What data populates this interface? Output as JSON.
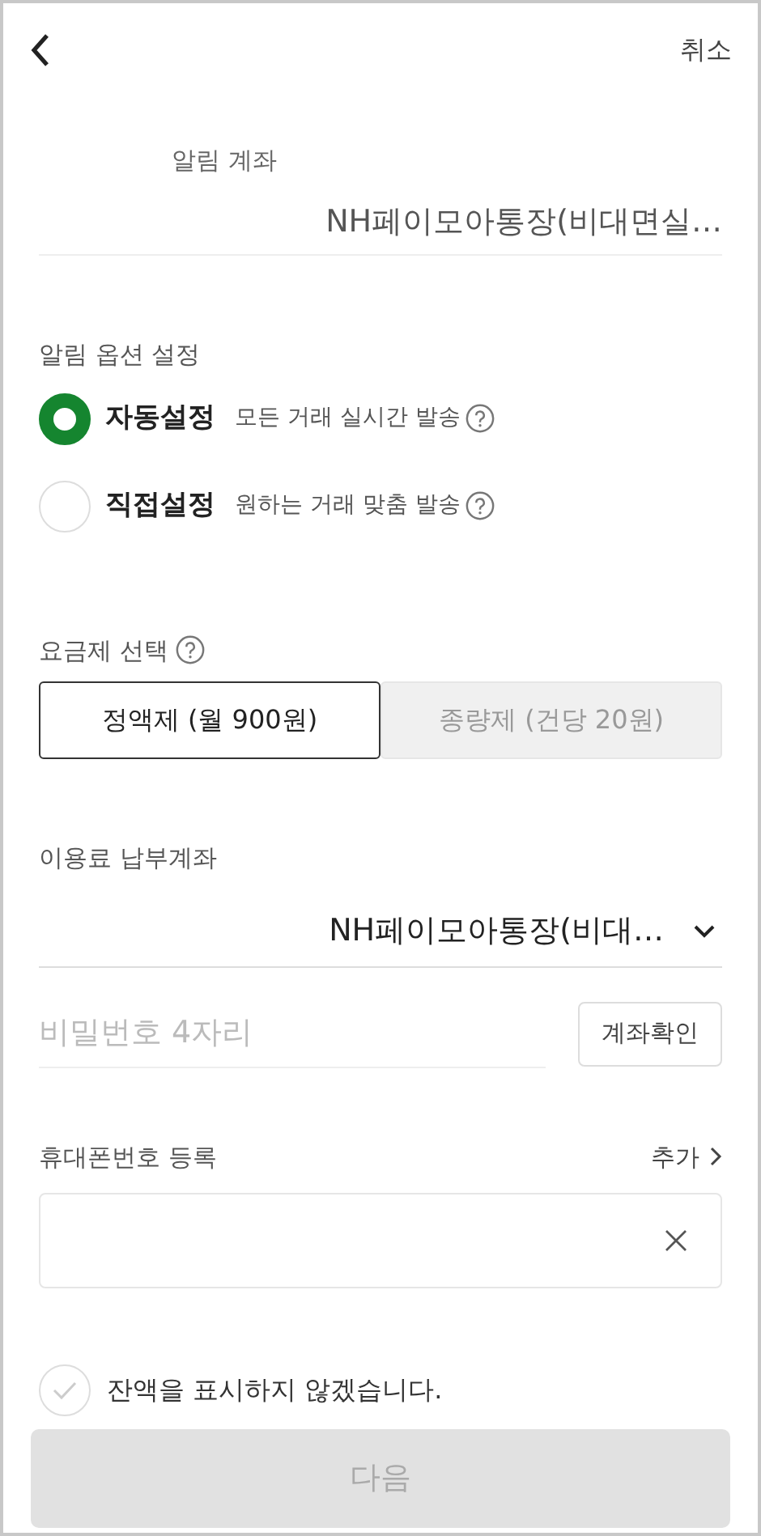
{
  "header": {
    "cancel": "취소"
  },
  "alert_account": {
    "label": "알림 계좌",
    "value": "NH페이모아통장(비대면실…"
  },
  "alert_options": {
    "title": "알림 옵션 설정",
    "options": [
      {
        "label": "자동설정",
        "description": "모든 거래 실시간 발송",
        "selected": true
      },
      {
        "label": "직접설정",
        "description": "원하는 거래 맞춤 발송",
        "selected": false
      }
    ]
  },
  "plan": {
    "title": "요금제 선택",
    "options": [
      {
        "label": "정액제 (월 900원)",
        "selected": true
      },
      {
        "label": "종량제 (건당 20원)",
        "selected": false
      }
    ]
  },
  "payment_account": {
    "label": "이용료 납부계좌",
    "value": "NH페이모아통장(비대…",
    "password_placeholder": "비밀번호 4자리",
    "verify_button": "계좌확인"
  },
  "phone": {
    "label": "휴대폰번호 등록",
    "add": "추가"
  },
  "hide_balance": {
    "label": "잔액을 표시하지 않겠습니다.",
    "checked": false
  },
  "next_button": {
    "label": "다음",
    "disabled": true
  }
}
